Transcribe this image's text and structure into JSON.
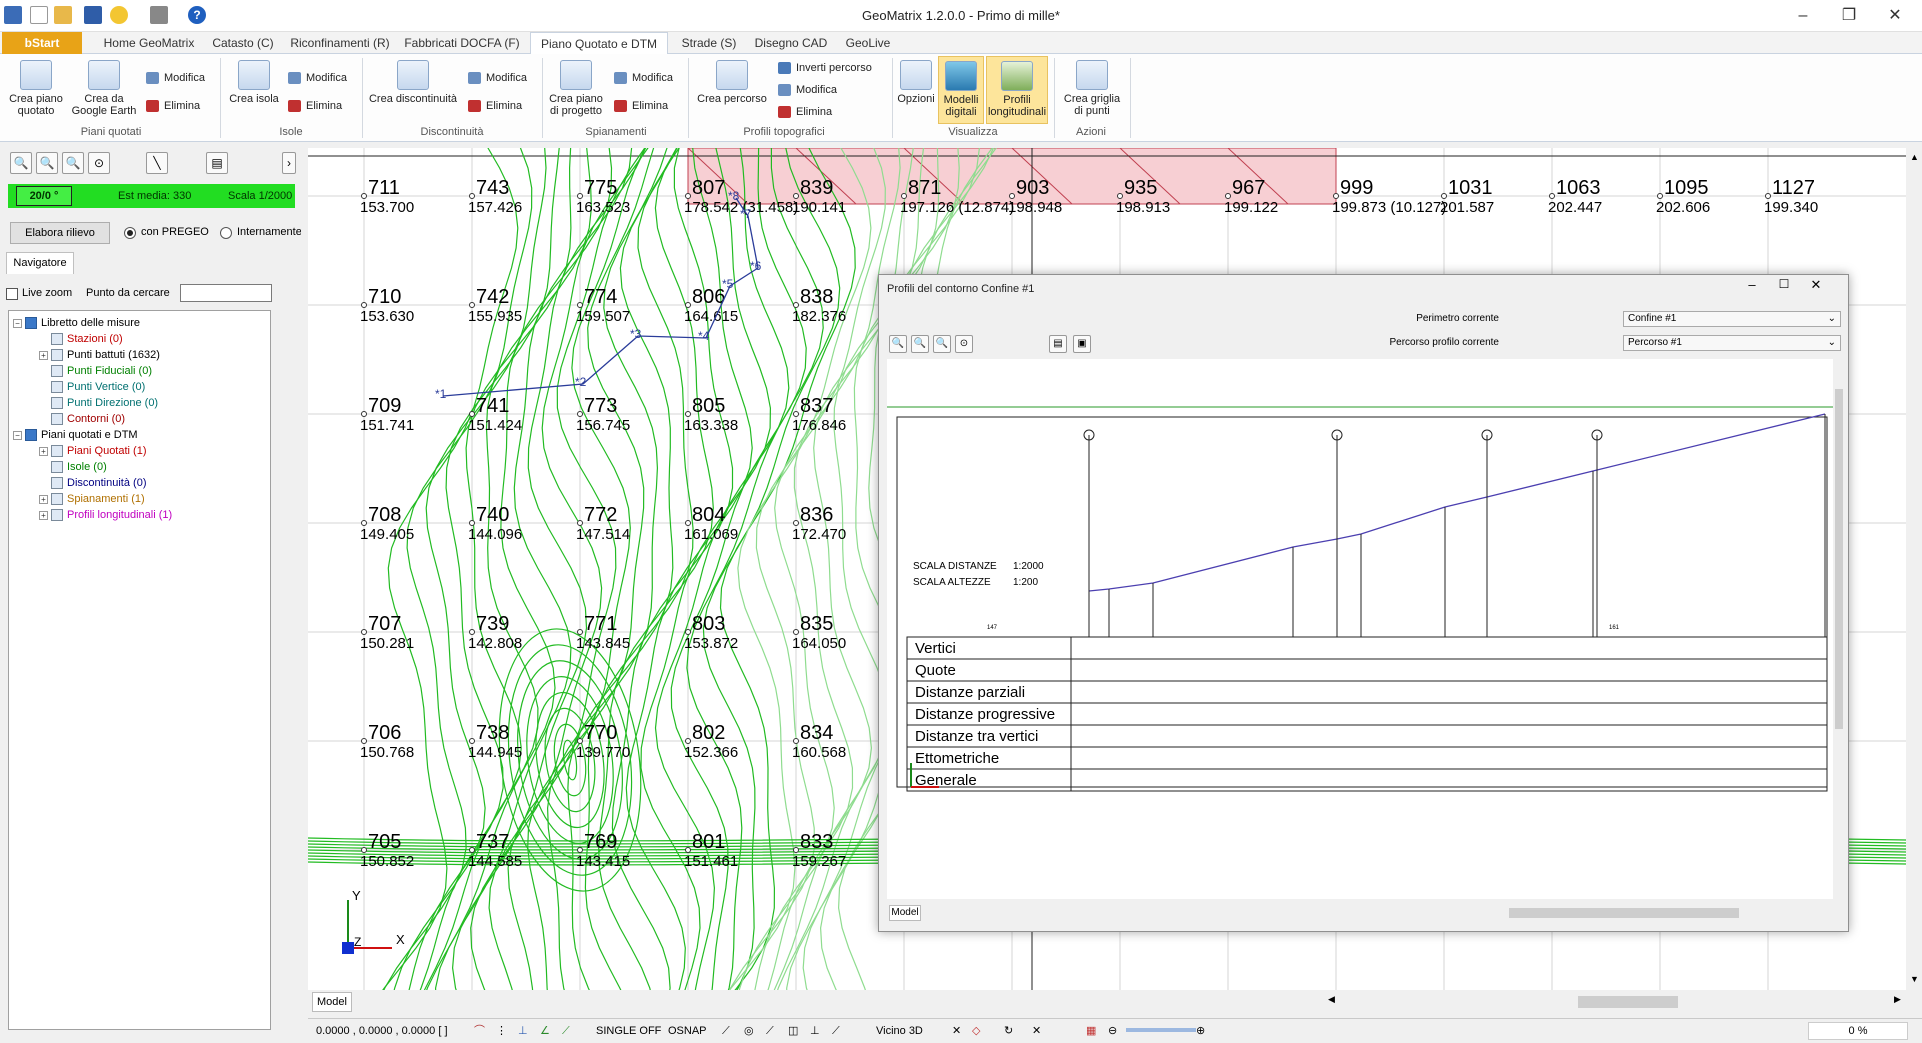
{
  "app": {
    "title": "GeoMatrix 1.2.0.0 - Primo di mille*"
  },
  "tabs": [
    "Home GeoMatrix",
    "Catasto (C)",
    "Riconfinamenti (R)",
    "Fabbricati DOCFA (F)",
    "Piano Quotato e DTM (Q)",
    "Strade (S)",
    "Disegno CAD",
    "GeoLive"
  ],
  "start_label": "bStart",
  "ribbon": {
    "crea_piano_quotato": "Crea piano quotato",
    "crea_google_earth": "Crea da Google Earth",
    "modifica": "Modifica",
    "elimina": "Elimina",
    "crea_isola": "Crea isola",
    "crea_discontinuita": "Crea discontinuità",
    "crea_piano_progetto": "Crea piano di progetto",
    "crea_percorso": "Crea percorso",
    "inverti_percorso": "Inverti percorso",
    "opzioni": "Opzioni",
    "modelli_digitali": "Modelli digitali",
    "profili_longitudinali": "Profili longitudinali",
    "crea_griglia": "Crea griglia di punti",
    "groups": [
      "Piani quotati",
      "Isole",
      "Discontinuità",
      "Spianamenti",
      "Profili topografici",
      "Visualizza",
      "Azioni"
    ]
  },
  "left": {
    "angle": "20/0 °",
    "est_media": "Est media: 330",
    "scala": "Scala 1/2000",
    "elabora_btn": "Elabora rilievo",
    "radio1": "con PREGEO",
    "radio2": "Internamente",
    "tab_navigatore": "Navigatore",
    "live_zoom": "Live zoom",
    "punto_label": "Punto da cercare",
    "punto_value": "",
    "tree": [
      {
        "label": "Libretto delle misure",
        "level": 0,
        "color": "#000000",
        "expand": "−"
      },
      {
        "label": "Stazioni (0)",
        "level": 1,
        "color": "#c00000",
        "expand": ""
      },
      {
        "label": "Punti battuti (1632)",
        "level": 1,
        "color": "#000000",
        "expand": "+"
      },
      {
        "label": "Punti Fiduciali (0)",
        "level": 1,
        "color": "#008000",
        "expand": ""
      },
      {
        "label": "Punti Vertice (0)",
        "level": 1,
        "color": "#007070",
        "expand": ""
      },
      {
        "label": "Punti Direzione (0)",
        "level": 1,
        "color": "#007070",
        "expand": ""
      },
      {
        "label": "Contorni (0)",
        "level": 1,
        "color": "#a00000",
        "expand": ""
      },
      {
        "label": "Piani quotati e DTM",
        "level": 0,
        "color": "#000000",
        "expand": "−"
      },
      {
        "label": "Piani Quotati (1)",
        "level": 1,
        "color": "#c00000",
        "expand": "+"
      },
      {
        "label": "Isole (0)",
        "level": 1,
        "color": "#008000",
        "expand": ""
      },
      {
        "label": "Discontinuità (0)",
        "level": 1,
        "color": "#000080",
        "expand": ""
      },
      {
        "label": "Spianamenti (1)",
        "level": 1,
        "color": "#b07000",
        "expand": "+"
      },
      {
        "label": "Profili longitudinali (1)",
        "level": 1,
        "color": "#c000c0",
        "expand": "+"
      }
    ]
  },
  "grid": {
    "columns": [
      {
        "top": [
          "711",
          "153.700"
        ],
        "rows": [
          [
            "710",
            "153.630"
          ],
          [
            "709",
            "151.741"
          ],
          [
            "708",
            "149.405"
          ],
          [
            "707",
            "150.281"
          ],
          [
            "706",
            "150.768"
          ],
          [
            "705",
            "150.852"
          ]
        ]
      },
      {
        "top": [
          "743",
          "157.426"
        ],
        "rows": [
          [
            "742",
            "155.935"
          ],
          [
            "741",
            "151.424"
          ],
          [
            "740",
            "144.096"
          ],
          [
            "739",
            "142.808"
          ],
          [
            "738",
            "144.945"
          ],
          [
            "737",
            "144.585"
          ]
        ]
      },
      {
        "top": [
          "775",
          "163.523"
        ],
        "rows": [
          [
            "774",
            "159.507"
          ],
          [
            "773",
            "156.745"
          ],
          [
            "772",
            "147.514"
          ],
          [
            "771",
            "143.845"
          ],
          [
            "770",
            "139.770"
          ],
          [
            "769",
            "143.415"
          ]
        ]
      },
      {
        "top": [
          "807",
          "178.542 (31.458)"
        ],
        "rows": [
          [
            "806",
            "164.615"
          ],
          [
            "805",
            "163.338"
          ],
          [
            "804",
            "161.069"
          ],
          [
            "803",
            "153.872"
          ],
          [
            "802",
            "152.366"
          ],
          [
            "801",
            "151.461"
          ]
        ]
      },
      {
        "top": [
          "839",
          "190.141"
        ],
        "rows": [
          [
            "838",
            "182.376"
          ],
          [
            "837",
            "176.846"
          ],
          [
            "836",
            "172.470"
          ],
          [
            "835",
            "164.050"
          ],
          [
            "834",
            "160.568"
          ],
          [
            "833",
            "159.267"
          ]
        ]
      },
      {
        "top": [
          "871",
          "197.126 (12.874)"
        ],
        "rows": []
      },
      {
        "top": [
          "903",
          "198.948"
        ],
        "rows": []
      },
      {
        "top": [
          "935",
          "198.913"
        ],
        "rows": []
      },
      {
        "top": [
          "967",
          "199.122"
        ],
        "rows": []
      },
      {
        "top": [
          "999",
          "199.873 (10.127)"
        ],
        "rows": []
      },
      {
        "top": [
          "1031",
          "201.587"
        ],
        "rows": []
      },
      {
        "top": [
          "1063",
          "202.447"
        ],
        "rows": []
      },
      {
        "top": [
          "1095",
          "202.606"
        ],
        "rows": []
      },
      {
        "top": [
          "1127",
          "199.340"
        ],
        "rows": []
      }
    ],
    "path_labels": [
      "1",
      "2",
      "3",
      "4",
      "5",
      "6",
      "7",
      "8"
    ]
  },
  "dialog": {
    "title": "Profili del contorno Confine #1",
    "perimetro_label": "Perimetro corrente",
    "perimetro_value": "Confine #1",
    "percorso_label": "Percorso profilo corrente",
    "percorso_value": "Percorso #1",
    "scala_distanze": "SCALA DISTANZE",
    "scala_distanze_val": "1:2000",
    "scala_altezze": "SCALA ALTEZZE",
    "scala_altezze_val": "1:200",
    "row_labels": [
      "Vertici",
      "Quote",
      "Distanze parziali",
      "Distanze progressive",
      "Distanze tra vertici",
      "Ettometriche",
      "Generale"
    ],
    "model_tab": "Model",
    "mark_left": "147",
    "mark_right": "161"
  },
  "status": {
    "model_tab": "Model",
    "coords": "0.0000 , 0.0000 , 0.0000 [ ]",
    "single": "SINGLE OFF",
    "osnap": "OSNAP",
    "vicino": "Vicino 3D",
    "percent": "0 %"
  },
  "colors": {
    "contour": "#22bb22",
    "zone": "#f7cfd3",
    "path": "#2a3c9a",
    "grid": "#bfbfbf",
    "accent": "#e8a317"
  }
}
